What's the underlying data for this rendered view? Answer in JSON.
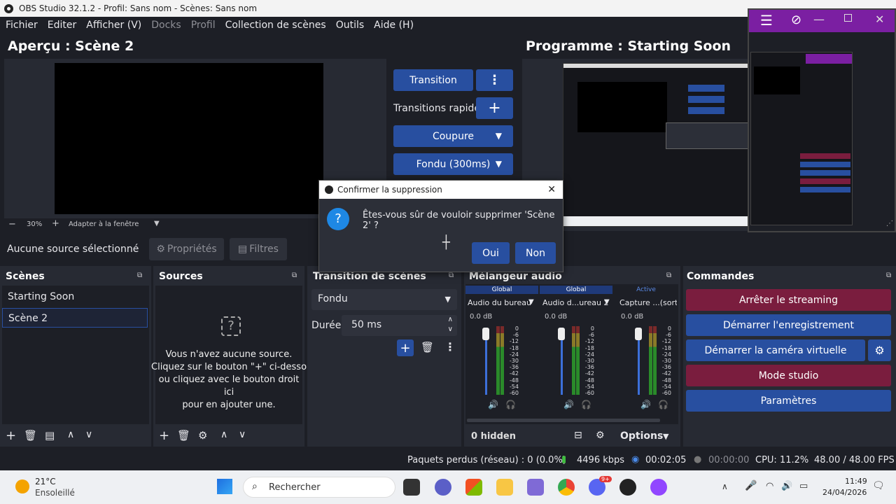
{
  "window": {
    "title": "OBS Studio 32.1.2 - Profil: Sans nom - Scènes: Sans nom"
  },
  "menu": [
    "Fichier",
    "Editer",
    "Afficher (V)",
    "Docks",
    "Profil",
    "Collection de scènes",
    "Outils",
    "Aide (H)"
  ],
  "preview": {
    "title": "Aperçu : Scène 2",
    "zoom": "30%",
    "fit": "Adapter à la fenêtre"
  },
  "program": {
    "title": "Programme : Starting Soon"
  },
  "transition_panel": {
    "transition": "Transition",
    "quick": "Transitions rapides",
    "cut": "Coupure",
    "fade": "Fondu (300ms)"
  },
  "source_bar": {
    "status": "Aucune source sélectionné",
    "properties": "Propriétés",
    "filters": "Filtres"
  },
  "scenes": {
    "title": "Scènes",
    "items": [
      "Starting Soon",
      "Scène 2"
    ]
  },
  "sources": {
    "title": "Sources",
    "empty": [
      "Vous n'avez aucune source.",
      "Cliquez sur le bouton \"+\" ci-dessous,",
      "ou cliquez avec le bouton droit ici",
      "pour en ajouter une."
    ]
  },
  "scene_transitions": {
    "title": "Transition de scènes",
    "type": "Fondu",
    "duration_label": "Durée",
    "duration": "50 ms"
  },
  "mixer": {
    "title": "Mélangeur audio",
    "channels": [
      {
        "tag": "Global",
        "name": "Audio du bureau",
        "db": "0.0 dB"
      },
      {
        "tag": "Global",
        "name": "Audio d...ureau 2",
        "db": "0.0 dB"
      },
      {
        "tag": "Active",
        "name": "Capture ...(sortie",
        "db": "0.0 dB"
      }
    ],
    "ticks": [
      "0",
      "-6",
      "-12",
      "-18",
      "-24",
      "-30",
      "-36",
      "-42",
      "-48",
      "-54",
      "-60"
    ],
    "hidden": "0 hidden",
    "options": "Options"
  },
  "controls": {
    "title": "Commandes",
    "stop_stream": "Arrêter le streaming",
    "start_record": "Démarrer l'enregistrement",
    "virtual_cam": "Démarrer la caméra virtuelle",
    "studio": "Mode studio",
    "settings": "Paramètres"
  },
  "status": {
    "dropped": "Paquets perdus (réseau) : 0 (0.0%)",
    "bitrate": "4496 kbps",
    "stream_time": "00:02:05",
    "rec_time": "00:00:00",
    "cpu": "CPU: 11.2%",
    "fps": "48.00 / 48.00 FPS"
  },
  "dialog": {
    "title": "Confirmer la suppression",
    "message": "Êtes-vous sûr de vouloir supprimer 'Scène 2' ?",
    "yes": "Oui",
    "no": "Non"
  },
  "taskbar": {
    "temp": "21°C",
    "weather": "Ensoleillé",
    "search": "Rechercher",
    "time": "11:49",
    "date": "24/04/2026",
    "badge": "9+"
  },
  "colors": {
    "accent_blue": "#284fa0",
    "accent_red": "#7a1d3e",
    "bg": "#1d1f26",
    "panel": "#272a33"
  }
}
